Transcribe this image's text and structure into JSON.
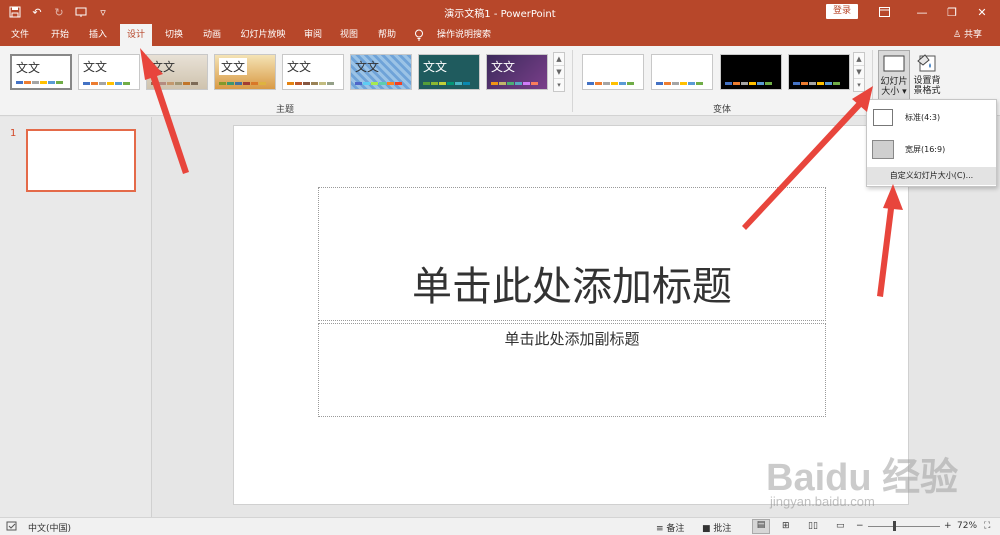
{
  "titlebar": {
    "doc_title": "演示文稿1  -  PowerPoint",
    "login_label": "登录",
    "qat": [
      "save-icon",
      "undo-icon",
      "redo-icon",
      "start-from-beginning-icon",
      "customize-qat-icon"
    ]
  },
  "tabs": [
    {
      "label": "文件"
    },
    {
      "label": "开始"
    },
    {
      "label": "插入"
    },
    {
      "label": "设计",
      "active": true
    },
    {
      "label": "切换"
    },
    {
      "label": "动画"
    },
    {
      "label": "幻灯片放映"
    },
    {
      "label": "审阅"
    },
    {
      "label": "视图"
    },
    {
      "label": "帮助"
    },
    {
      "label": "操作说明搜索"
    }
  ],
  "share_label": "共享",
  "ribbon": {
    "themes_group_label": "主题",
    "variants_group_label": "变体",
    "theme_thumb_text": "文文",
    "slide_size_label_line1": "幻灯片",
    "slide_size_label_line2": "大小 ▾",
    "format_bg_label_line1": "设置背",
    "format_bg_label_line2": "景格式"
  },
  "dropdown": {
    "standard": "标准(4:3)",
    "widescreen": "宽屏(16:9)",
    "custom": "自定义幻灯片大小(C)..."
  },
  "thumbpane": {
    "slide_number": "1"
  },
  "slide": {
    "title_placeholder": "单击此处添加标题",
    "subtitle_placeholder": "单击此处添加副标题"
  },
  "statusbar": {
    "language": "中文(中国)",
    "notes_label": "备注",
    "comments_label": "批注",
    "zoom": "72%"
  },
  "watermark": {
    "brand": "Baidu 经验",
    "url": "jingyan.baidu.com"
  },
  "colors": {
    "accent": "#b7472a",
    "arrow": "#e8453c"
  }
}
